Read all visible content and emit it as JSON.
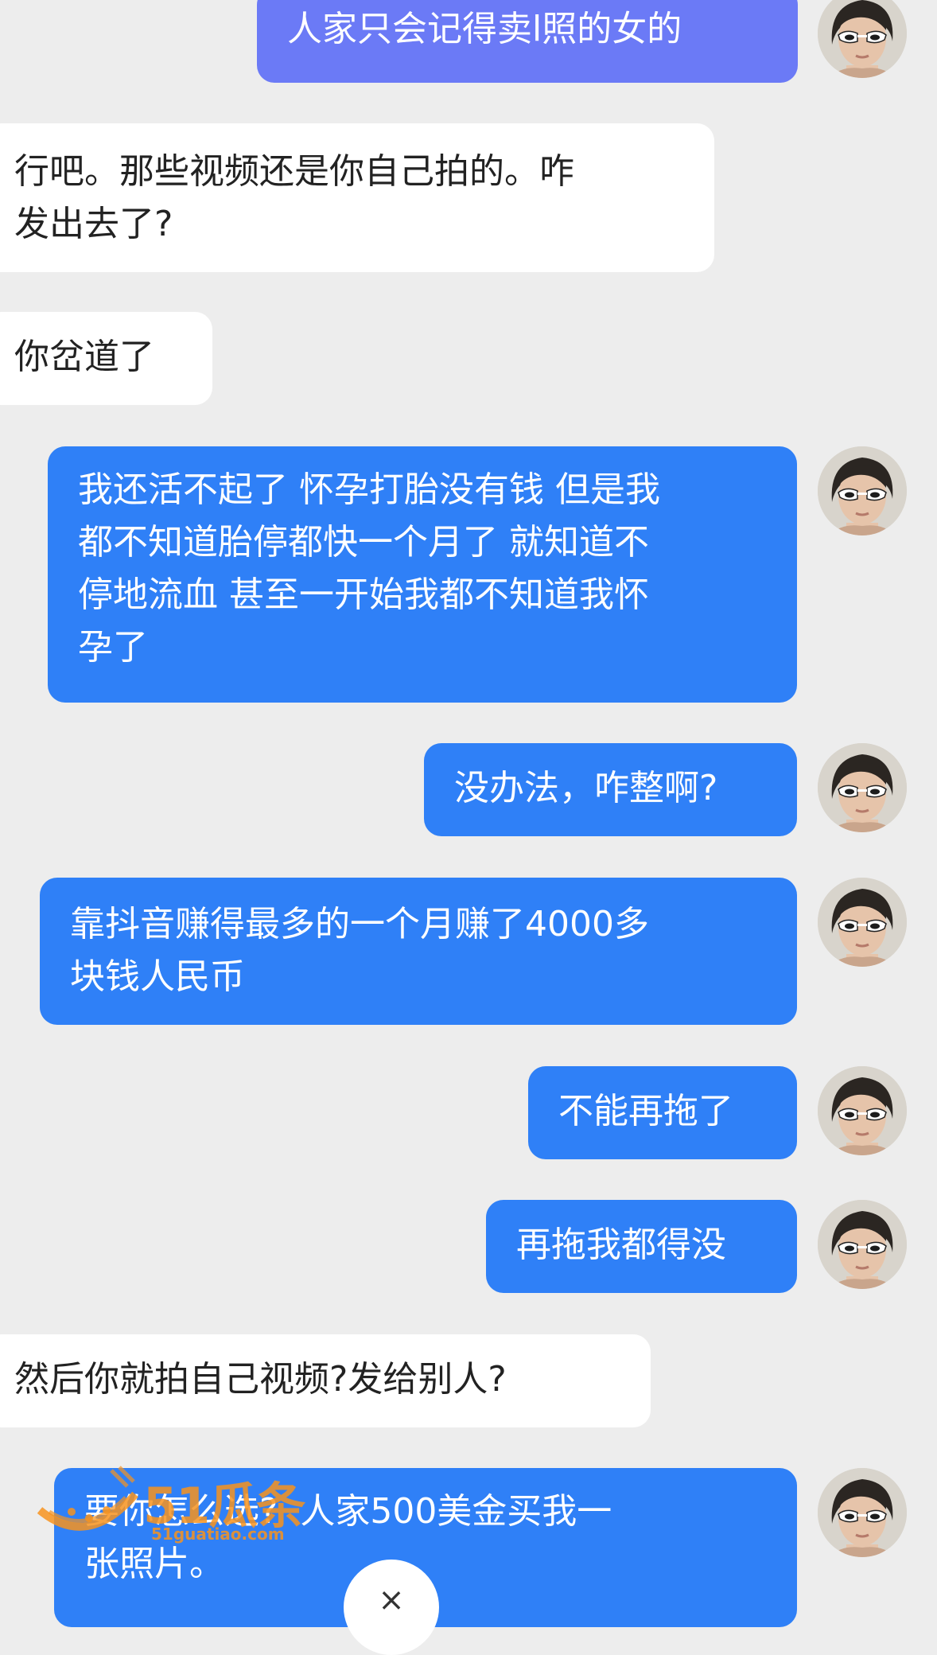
{
  "messages": [
    {
      "side": "sent",
      "text": "人家只会记得卖l照的女的"
    },
    {
      "side": "recv",
      "text": "行吧。那些视频还是你自己拍的。咋\n发出去了?"
    },
    {
      "side": "recv",
      "text": "你岔道了"
    },
    {
      "side": "sent",
      "text": "我还活不起了 怀孕打胎没有钱 但是我\n都不知道胎停都快一个月了 就知道不\n停地流血 甚至一开始我都不知道我怀\n孕了"
    },
    {
      "side": "sent",
      "text": "没办法，咋整啊?"
    },
    {
      "side": "sent",
      "text": "靠抖音赚得最多的一个月赚了4000多\n块钱人民币"
    },
    {
      "side": "sent",
      "text": "不能再拖了"
    },
    {
      "side": "sent",
      "text": "再拖我都得没"
    },
    {
      "side": "recv",
      "text": "然后你就拍自己视频?发给别人?"
    },
    {
      "side": "sent",
      "text": "要你怎么选?  人家500美金买我一\n张照片。"
    }
  ],
  "watermark": {
    "logo": "51瓜条",
    "url": "51guatiao.com"
  },
  "close_button": {
    "icon": "close-icon",
    "glyph": "×"
  },
  "colors": {
    "sent_bubble": "#2f80f7",
    "recv_bubble": "#ffffff",
    "background": "#ededed"
  }
}
